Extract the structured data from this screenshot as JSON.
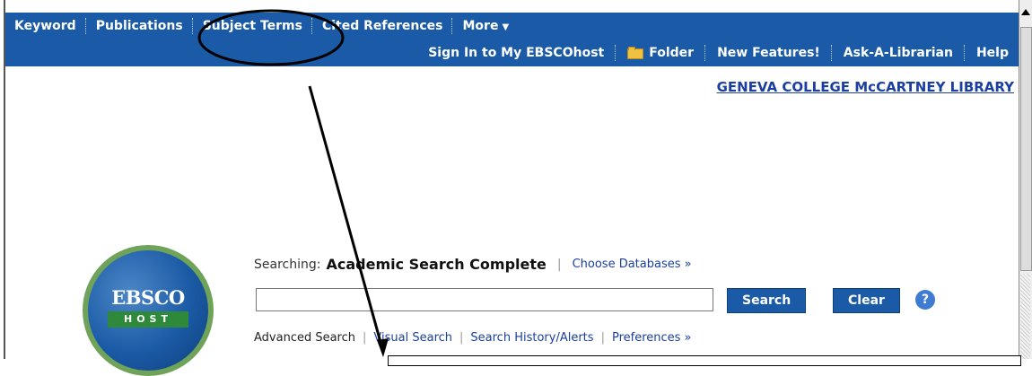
{
  "topbar": {
    "nav_primary": [
      "Keyword",
      "Publications",
      "Subject Terms",
      "Cited References",
      "More"
    ],
    "nav_secondary": [
      "Sign In to My EBSCOhost",
      "Folder",
      "New Features!",
      "Ask-A-Librarian",
      "Help"
    ]
  },
  "header": {
    "library_link": "GENEVA COLLEGE McCARTNEY LIBRARY"
  },
  "logo": {
    "line1": "EBSCO",
    "line2": "HOST"
  },
  "search": {
    "searching_label": "Searching:",
    "database": "Academic Search Complete",
    "choose_databases": "Choose Databases »",
    "input_value": "",
    "search_button": "Search",
    "clear_button": "Clear",
    "help_icon": "?"
  },
  "links": [
    "Advanced Search",
    "Visual Search",
    "Search History/Alerts",
    "Preferences »"
  ],
  "colors": {
    "nav_bg": "#1b5aa6",
    "link": "#1b3fa0",
    "active_nav": "#ffcc00"
  }
}
